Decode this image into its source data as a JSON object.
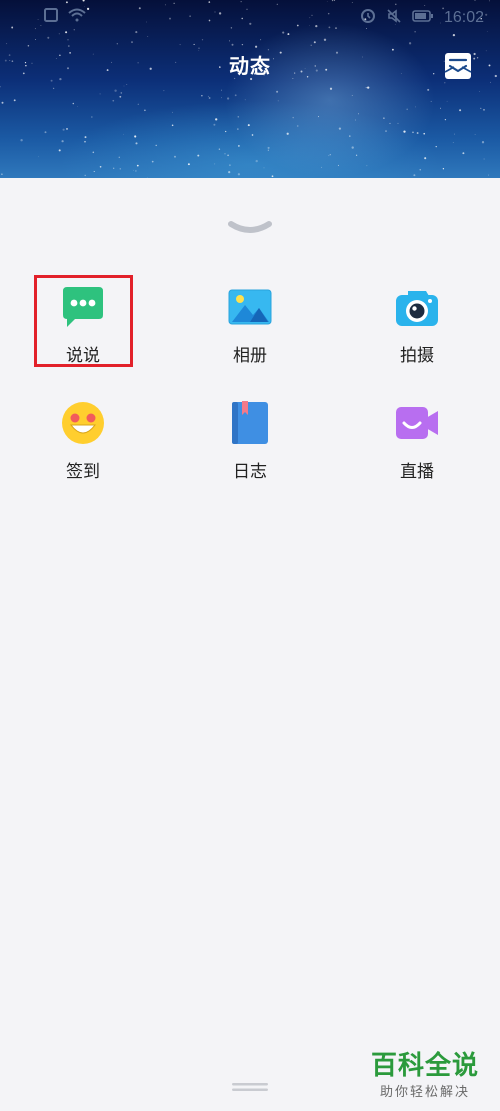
{
  "header": {
    "title": "动态",
    "mail_icon": "mail-icon",
    "background": "starry-night"
  },
  "status_bar": {
    "time": "16:02",
    "icons": [
      "sim-icon",
      "wifi-icon",
      "alarm-icon",
      "mute-icon",
      "battery-icon"
    ]
  },
  "panel": {
    "collapse_icon": "chevron-down-icon",
    "highlighted_item": "说说",
    "highlight_color": "#e2202a",
    "items": [
      {
        "label": "说说",
        "icon": "chat-bubble-icon",
        "color": "#2ec27e"
      },
      {
        "label": "相册",
        "icon": "photo-album-icon",
        "color": "#37b8f0"
      },
      {
        "label": "拍摄",
        "icon": "camera-icon",
        "color": "#2ab3ec"
      },
      {
        "label": "签到",
        "icon": "smiley-icon",
        "color": "#ffce2e"
      },
      {
        "label": "日志",
        "icon": "diary-book-icon",
        "color": "#3f8fe3"
      },
      {
        "label": "直播",
        "icon": "video-camera-icon",
        "color": "#b86ef0"
      }
    ],
    "bottom_handle_icon": "drag-handle-icon"
  },
  "watermark": {
    "main": "百科全说",
    "sub": "助你轻松解决",
    "color": "#2b9a3c"
  }
}
